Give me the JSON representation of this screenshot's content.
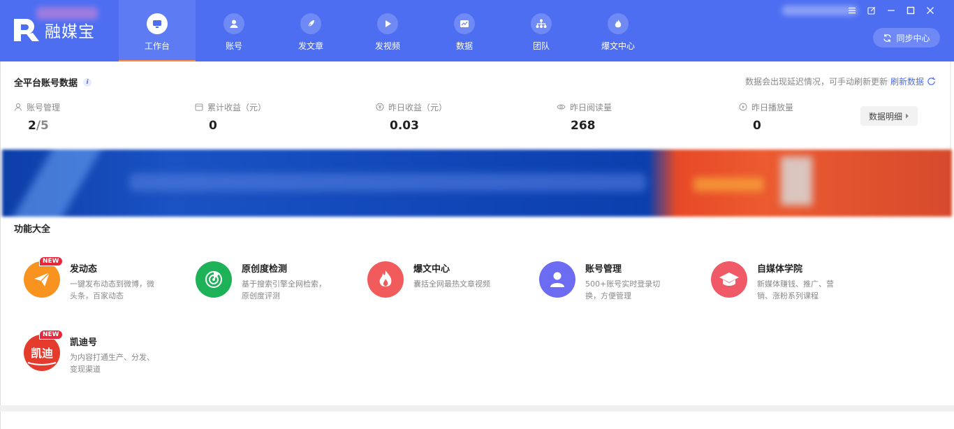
{
  "app": {
    "name": "融媒宝"
  },
  "nav": [
    {
      "label": "工作台",
      "icon": "monitor-icon",
      "active": true
    },
    {
      "label": "账号",
      "icon": "user-icon",
      "active": false
    },
    {
      "label": "发文章",
      "icon": "feather-icon",
      "active": false
    },
    {
      "label": "发视频",
      "icon": "play-icon",
      "active": false
    },
    {
      "label": "数据",
      "icon": "chart-icon",
      "active": false
    },
    {
      "label": "团队",
      "icon": "team-icon",
      "active": false
    },
    {
      "label": "爆文中心",
      "icon": "fire-icon",
      "active": false
    }
  ],
  "header": {
    "sync_label": "同步中心"
  },
  "colors": {
    "primary": "#4e6ef2",
    "accent_underline": "#ff8a3d",
    "badge_red": "#e8273a"
  },
  "account_data": {
    "title": "全平台账号数据",
    "notice": "数据会出现延迟情况，可手动刷新更新",
    "refresh_label": "刷新数据",
    "detail_button": "数据明细",
    "stats": [
      {
        "label": "账号管理",
        "icon": "user-outline-icon",
        "value": "2",
        "total": "/5"
      },
      {
        "label": "累计收益（元）",
        "icon": "wallet-icon",
        "value": "0"
      },
      {
        "label": "昨日收益（元）",
        "icon": "yen-icon",
        "value": "0.03"
      },
      {
        "label": "昨日阅读量",
        "icon": "eye-icon",
        "value": "268"
      },
      {
        "label": "昨日播放量",
        "icon": "play-outline-icon",
        "value": "0"
      }
    ]
  },
  "features": {
    "title": "功能大全",
    "items": [
      {
        "name": "发动态",
        "desc": "一键发布动态到微博，微头条，百家动态",
        "icon": "paper-plane-icon",
        "badge": "NEW",
        "color": "#f7931e"
      },
      {
        "name": "原创度检测",
        "desc": "基于搜索引擎全网检索，原创度评测",
        "icon": "radar-icon",
        "color": "#1db257"
      },
      {
        "name": "爆文中心",
        "desc": "囊括全网最热文章视频",
        "icon": "fire-icon",
        "color": "#f15b5b"
      },
      {
        "name": "账号管理",
        "desc": "500+账号实时登录切换，方便管理",
        "icon": "user-icon",
        "color": "#6b6cf2"
      },
      {
        "name": "自媒体学院",
        "desc": "新媒体赚钱、推广、营销、涨粉系列课程",
        "icon": "graduation-cap-icon",
        "color": "#f05a67"
      },
      {
        "name": "凯迪号",
        "desc": "为内容打通生产、分发、变现渠道",
        "icon": "kaidi-logo-icon",
        "badge": "NEW",
        "logo_text": "凯迪",
        "color": "#e53b2c"
      }
    ]
  }
}
